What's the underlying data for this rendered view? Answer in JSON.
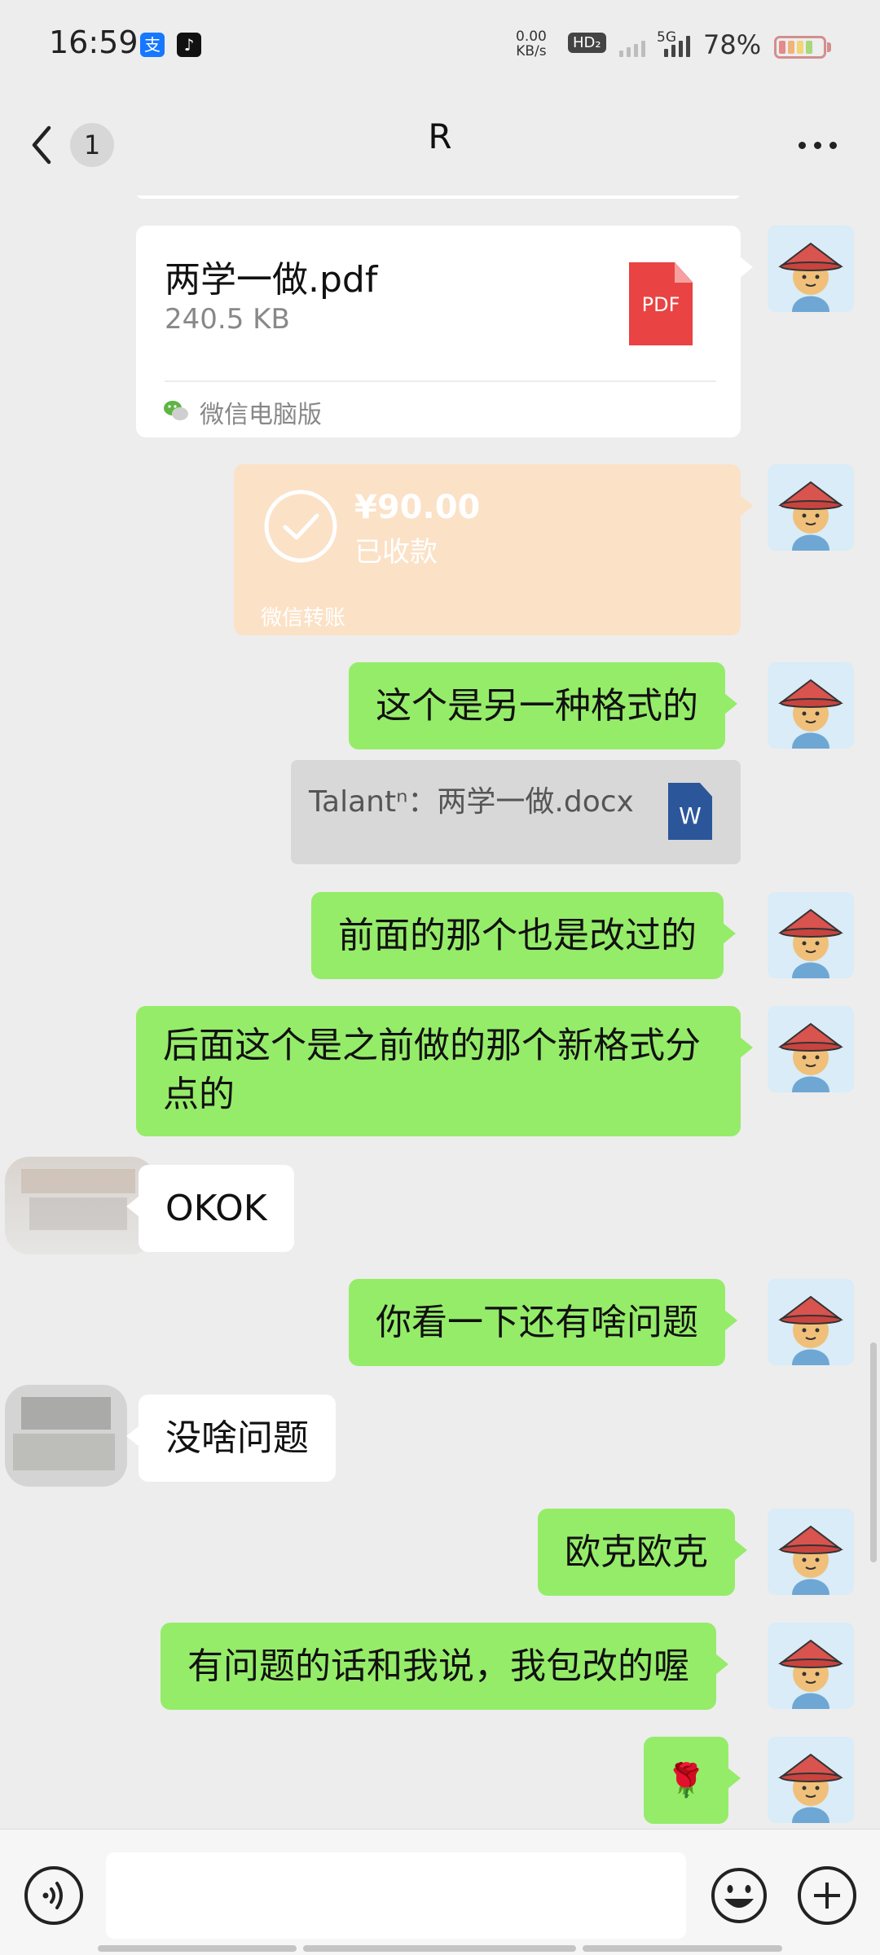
{
  "status_bar": {
    "time": "16:59",
    "alipay_glyph": "支",
    "tiktok_glyph": "♪",
    "net_speed_value": "0.00",
    "net_speed_unit": "KB/s",
    "hd_label": "HD₂",
    "network_label": "5G",
    "battery": "78%",
    "icons": [
      "alipay-icon",
      "tiktok-icon",
      "hd-icon",
      "signal-icon",
      "battery-icon"
    ]
  },
  "header": {
    "unread_count": "1",
    "title": "R",
    "icons": [
      "back-arrow-icon",
      "more-icon"
    ]
  },
  "messages": {
    "file": {
      "name": "两学一做.pdf",
      "size": "240.5 KB",
      "type_label": "PDF",
      "source": "微信电脑版"
    },
    "transfer": {
      "amount": "¥90.00",
      "status": "已收款",
      "source": "微信转账"
    },
    "m1": "这个是另一种格式的",
    "quote": {
      "text": "Talantⁿ：两学一做.docx",
      "icon_label": "W"
    },
    "m2": "前面的那个也是改过的",
    "m3": "后面这个是之前做的那个新格式分点的",
    "m4": "OKOK",
    "m5": "你看一下还有啥问题",
    "m6": "没啥问题",
    "m7": "欧克欧克",
    "m8": "有问题的话和我说，我包改的喔",
    "m9": "🌹"
  },
  "input_bar": {
    "value": "",
    "placeholder": "",
    "icons": [
      "voice-icon",
      "emoji-icon",
      "plus-icon"
    ]
  },
  "colors": {
    "sent_bubble": "#95ec69",
    "received_bubble": "#ffffff",
    "transfer_card": "#fbe1c6",
    "background": "#ededed"
  }
}
